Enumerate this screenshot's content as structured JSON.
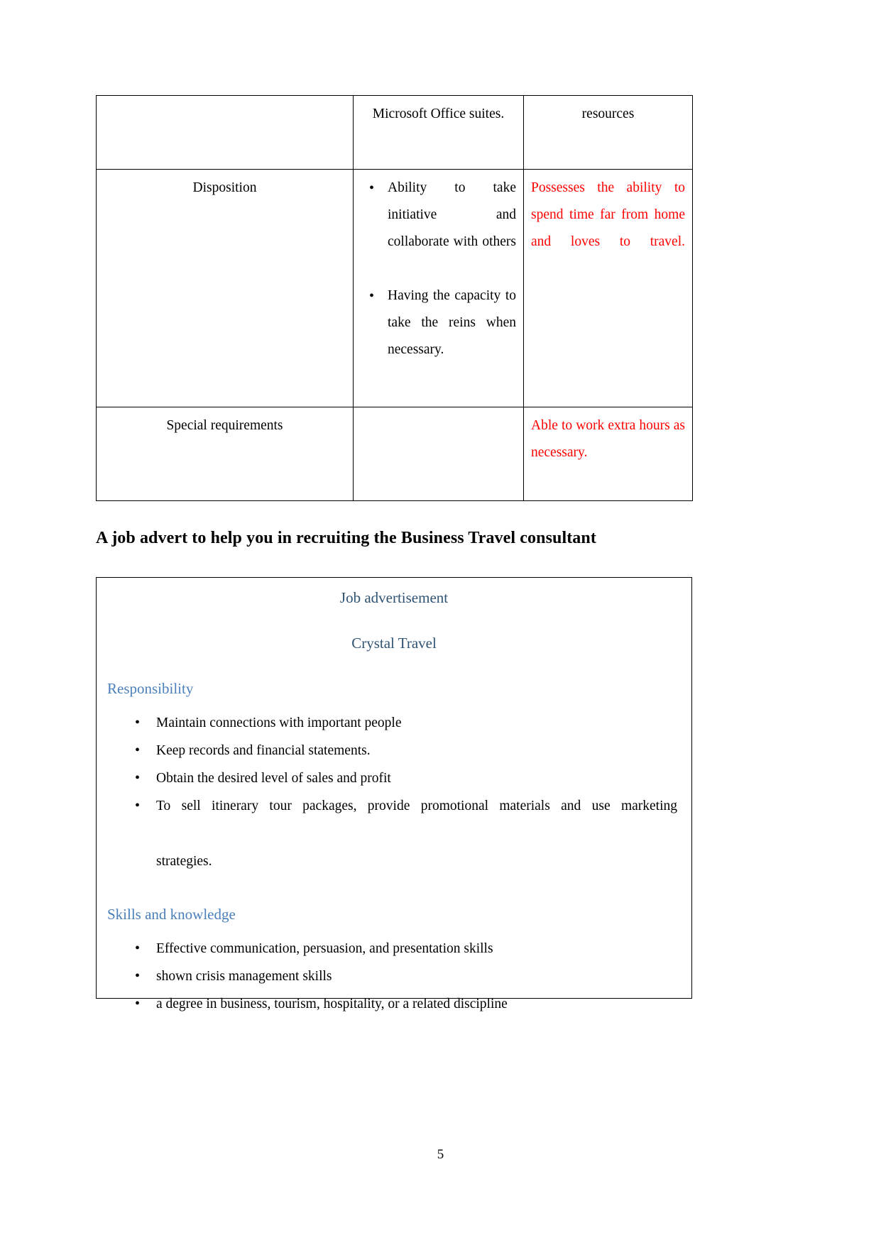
{
  "document": {
    "page_number": "5",
    "heading": "A job advert to help you in recruiting the Business Travel consultant"
  },
  "table": {
    "rows": [
      {
        "criteria": "",
        "essential": "Microsoft Office suites.",
        "desirable": "resources"
      },
      {
        "criteria": "Disposition",
        "essential_bullets": [
          "Ability to take initiative and collaborate with others",
          "Having the capacity to take the reins when necessary."
        ],
        "desirable": "Possesses the ability to spend time far from home and loves to travel."
      },
      {
        "criteria": "Special requirements",
        "essential": "",
        "desirable": "Able to work extra hours as necessary."
      }
    ]
  },
  "advert": {
    "title": "Job advertisement",
    "company": "Crystal Travel",
    "sections": [
      {
        "heading": "Responsibility",
        "items": [
          "Maintain connections with important people",
          "Keep records and financial statements.",
          "Obtain the desired level of sales and profit",
          "To sell itinerary tour packages, provide promotional materials and use marketing",
          "strategies."
        ]
      },
      {
        "heading": "Skills and knowledge",
        "items": [
          "Effective communication, persuasion, and presentation skills",
          "shown crisis management skills",
          "a degree in business, tourism, hospitality, or a related discipline"
        ]
      }
    ]
  },
  "colors": {
    "red_text": "#ff0000",
    "header_blue": "#2f5373",
    "subheading_blue": "#4a7fba",
    "border": "#000000"
  }
}
